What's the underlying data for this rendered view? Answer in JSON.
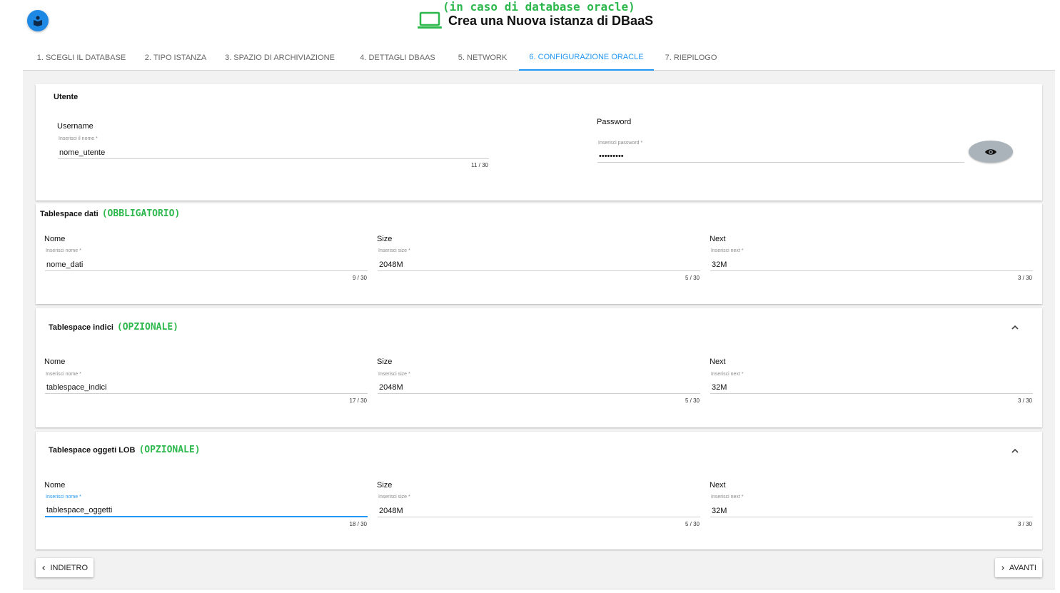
{
  "header": {
    "annotation": "(in caso di database oracle)",
    "title": "Crea una Nuova istanza di DBaaS"
  },
  "tabs": [
    {
      "label": "1. SCEGLI IL DATABASE"
    },
    {
      "label": "2. TIPO ISTANZA"
    },
    {
      "label": "3. SPAZIO DI ARCHIVIAZIONE"
    },
    {
      "label": "4. DETTAGLI DBAAS"
    },
    {
      "label": "5. NETWORK"
    },
    {
      "label": "6. CONFIGURAZIONE ORACLE"
    },
    {
      "label": "7. RIEPILOGO"
    }
  ],
  "active_tab": "6. CONFIGURAZIONE ORACLE",
  "user_section": {
    "title": "Utente",
    "username": {
      "label": "Username",
      "placeholder": "Inserisci il nome *",
      "value": "nome_utente",
      "counter": "11 / 30"
    },
    "password": {
      "label": "Password",
      "placeholder": "Inserisci password *",
      "value": "•••••••••"
    }
  },
  "tablespace_dati": {
    "title": "Tablespace dati",
    "annotation": "(OBBLIGATORIO)",
    "nome": {
      "label": "Nome",
      "placeholder": "Inserisci nome *",
      "value": "nome_dati",
      "counter": "9 / 30"
    },
    "size": {
      "label": "Size",
      "placeholder": "Inserisci size *",
      "value": "2048M",
      "counter": "5 / 30"
    },
    "next": {
      "label": "Next",
      "placeholder": "Inserisci next *",
      "value": "32M",
      "counter": "3 / 30"
    }
  },
  "tablespace_indici": {
    "title": "Tablespace indici",
    "annotation": "(OPZIONALE)",
    "nome": {
      "label": "Nome",
      "placeholder": "Inserisci nome *",
      "value": "tablespace_indici",
      "counter": "17 / 30"
    },
    "size": {
      "label": "Size",
      "placeholder": "Inserisci size *",
      "value": "2048M",
      "counter": "5 / 30"
    },
    "next": {
      "label": "Next",
      "placeholder": "Inserisci next *",
      "value": "32M",
      "counter": "3 / 30"
    }
  },
  "tablespace_lob": {
    "title": "Tablespace oggeti LOB",
    "annotation": "(OPZIONALE)",
    "nome": {
      "label": "Nome",
      "placeholder": "Inserisci nome *",
      "value": "tablespace_oggetti",
      "counter": "18 / 30"
    },
    "size": {
      "label": "Size",
      "placeholder": "Inserisci size *",
      "value": "2048M",
      "counter": "5 / 30"
    },
    "next": {
      "label": "Next",
      "placeholder": "Inserisci next *",
      "value": "32M",
      "counter": "3 / 30"
    }
  },
  "footer": {
    "back_label": "INDIETRO",
    "next_label": "AVANTI"
  },
  "colors": {
    "accent": "#2196f3",
    "annotation": "#2db84d",
    "logo": "#1e88e5"
  }
}
